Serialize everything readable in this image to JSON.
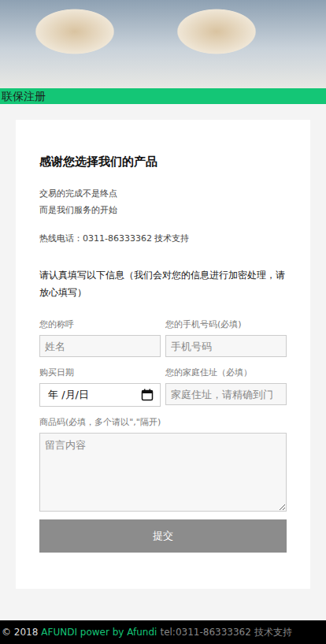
{
  "header": {
    "title": "联保注册"
  },
  "intro": {
    "title": "感谢您选择我们的产品",
    "lines": [
      "交易的完成不是终点",
      "而是我们服务的开始"
    ],
    "hotline": "热线电话：0311-86333362 技术支持",
    "notice": "请认真填写以下信息（我们会对您的信息进行加密处理，请放心填写）"
  },
  "form": {
    "fields": [
      {
        "kind": "text",
        "label": "您的称呼",
        "placeholder": "姓名"
      },
      {
        "kind": "text",
        "label": "您的手机号码(必填)",
        "placeholder": "手机号码"
      },
      {
        "kind": "date",
        "label": "购买日期",
        "placeholder": "年 /月/日"
      },
      {
        "kind": "text",
        "label": "您的家庭住址（必填）",
        "placeholder": "家庭住址，请精确到门"
      },
      {
        "kind": "textarea",
        "label": "商品码(必填，多个请以\",\"隔开)",
        "placeholder": "留言内容"
      }
    ],
    "submit": "提交"
  },
  "footer": {
    "copyright": "© 2018",
    "brand": "AFUNDI power by Afundi",
    "contact": "tel:0311-86333362 技术支持"
  }
}
